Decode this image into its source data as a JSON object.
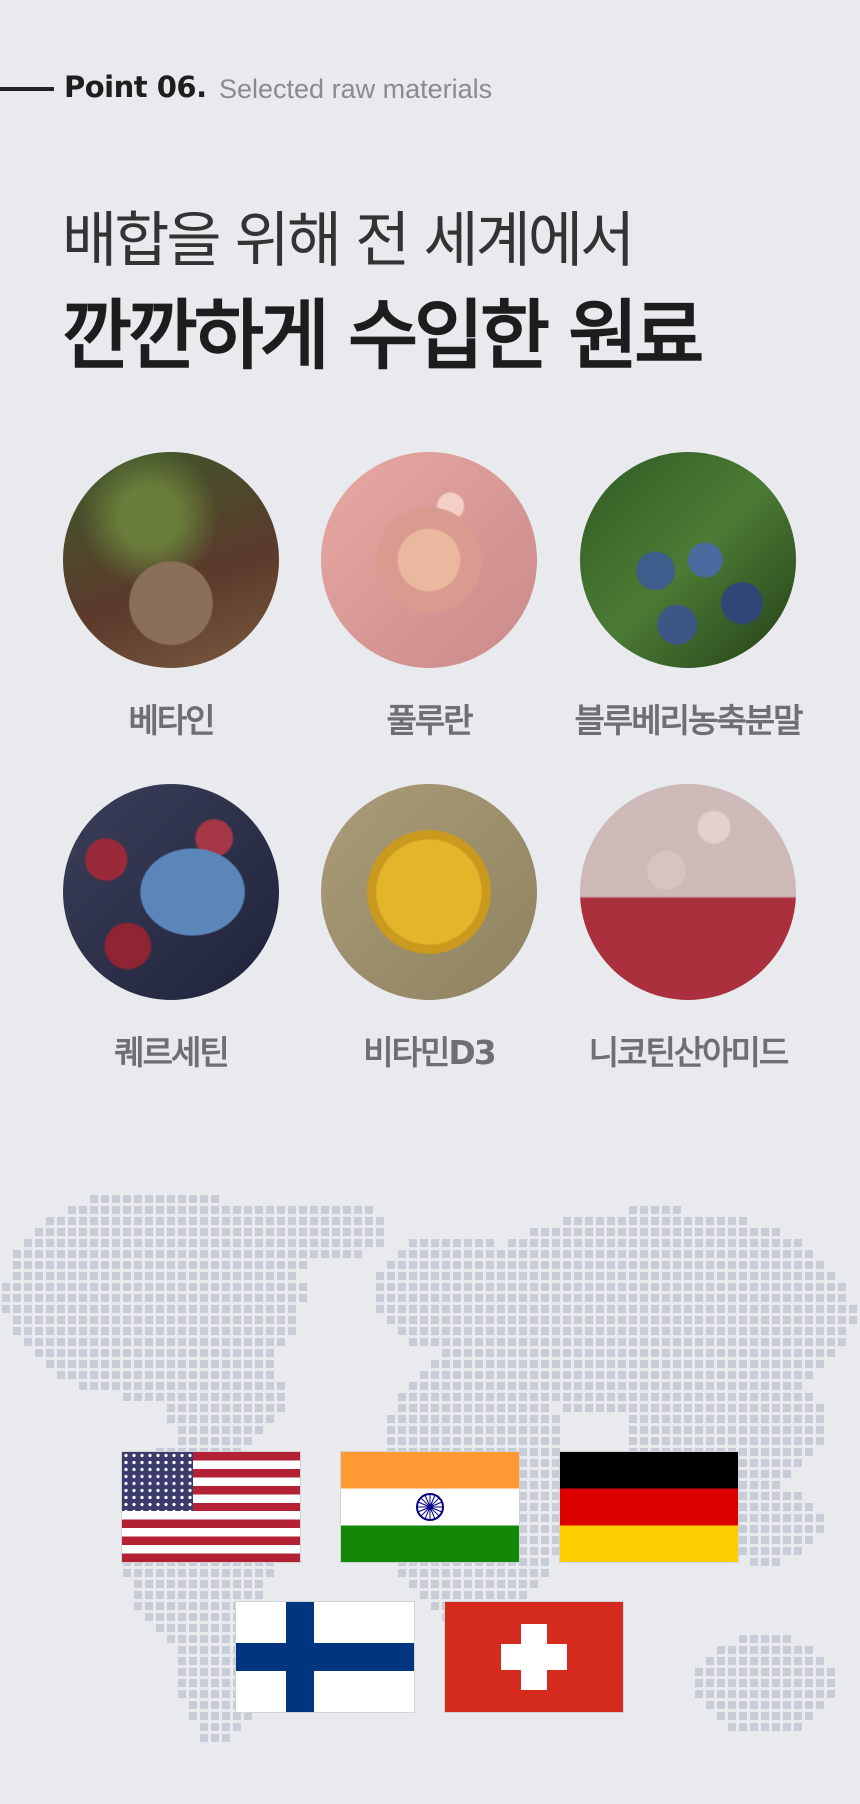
{
  "header": {
    "point_label": "Point 06.",
    "point_subtitle": "Selected raw materials",
    "headline_line1": "배합을 위해 전 세계에서",
    "headline_line2": "깐깐하게 수입한 원료"
  },
  "ingredients": [
    {
      "name": "베타인",
      "image": "beet-root-photo"
    },
    {
      "name": "풀루란",
      "image": "pullulan-capsule-photo"
    },
    {
      "name": "블루베리농축분말",
      "image": "blueberry-photo"
    },
    {
      "name": "퀘르세틴",
      "image": "virus-shield-photo"
    },
    {
      "name": "비타민D3",
      "image": "vitamin-d3-softgel-photo"
    },
    {
      "name": "니코틴산아미드",
      "image": "molecule-bubbles-photo"
    }
  ],
  "origin_flags": [
    {
      "country": "United States",
      "icon": "us-flag"
    },
    {
      "country": "India",
      "icon": "india-flag"
    },
    {
      "country": "Germany",
      "icon": "germany-flag"
    },
    {
      "country": "Finland",
      "icon": "finland-flag"
    },
    {
      "country": "Switzerland",
      "icon": "switzerland-flag"
    }
  ],
  "colors": {
    "background": "#e9eaee",
    "heading": "#1d1d1d",
    "ingredient_label": "#6e6e73",
    "map_dot": "#c8ccd6"
  }
}
